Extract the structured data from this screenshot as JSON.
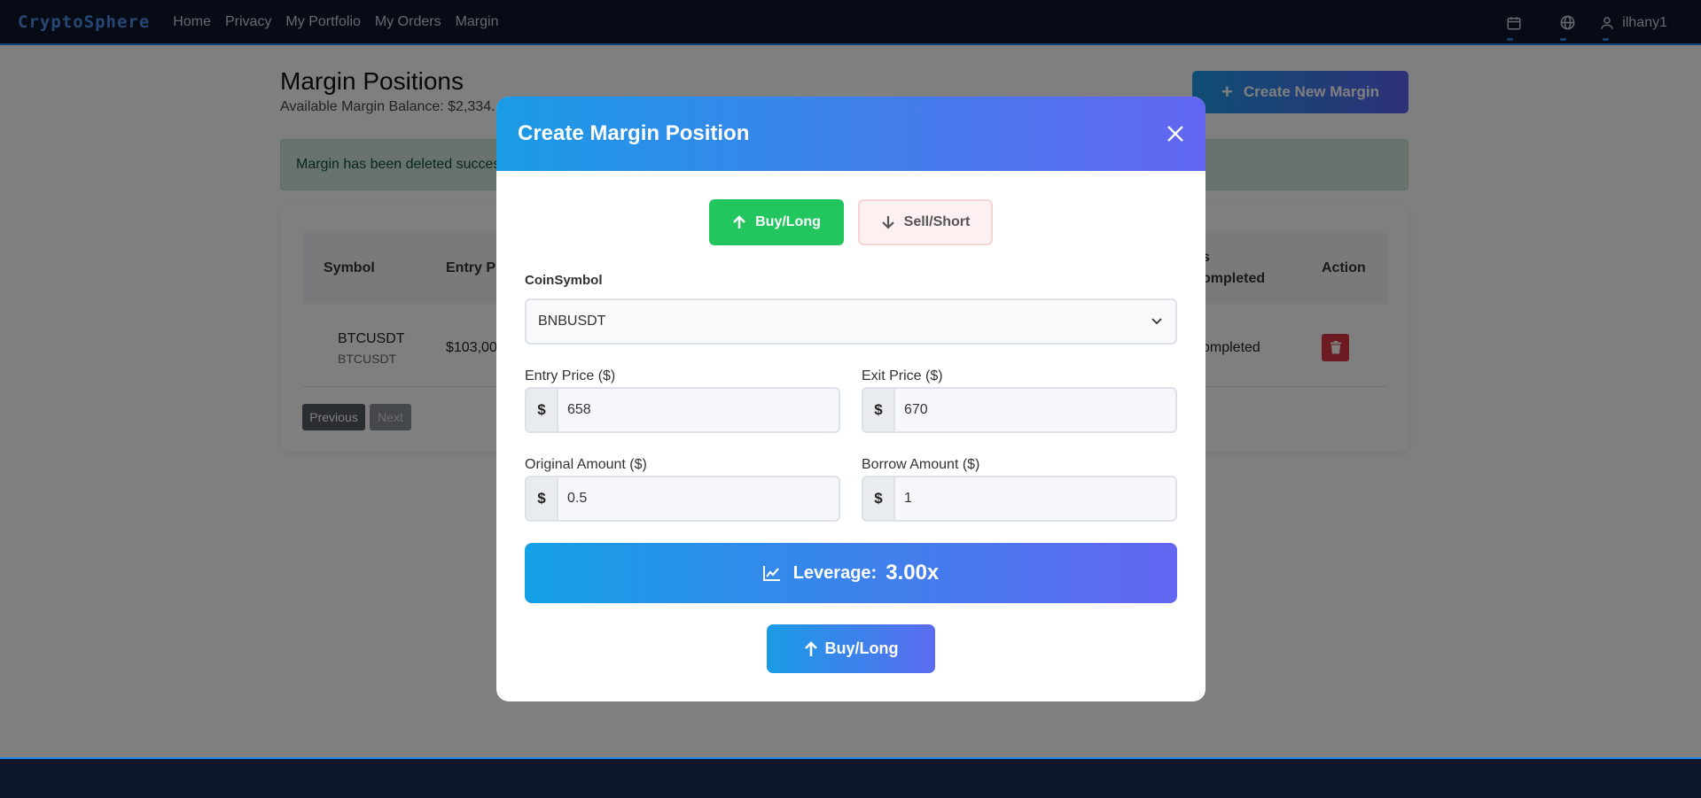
{
  "nav": {
    "brand": "CryptoSphere",
    "links": [
      "Home",
      "Privacy",
      "My Portfolio",
      "My Orders",
      "Margin"
    ],
    "user": "ilhany1",
    "accent": "#1e88e5"
  },
  "page": {
    "title": "Margin Positions",
    "balance": "Available Margin Balance: $2,334.",
    "create_button": "Create New Margin",
    "alert": "Margin has been deleted succes"
  },
  "table": {
    "headers": {
      "symbol": "Symbol",
      "entry": "Entry P",
      "status_top": "s",
      "status": "ompleted",
      "action": "Action"
    },
    "row": {
      "symbol": "BTCUSDT",
      "symbol_sub": "BTCUSDT",
      "entry": "$103,00",
      "status": "ompleted"
    },
    "pagination": {
      "previous": "Previous",
      "next": "Next"
    }
  },
  "modal": {
    "title": "Create Margin Position",
    "buy_toggle": "Buy/Long",
    "sell_toggle": "Sell/Short",
    "coin_label": "CoinSymbol",
    "coin_value": "BNBUSDT",
    "entry_label": "Entry Price ($)",
    "entry_value": "658",
    "exit_label": "Exit Price ($)",
    "exit_value": "670",
    "original_label": "Original Amount ($)",
    "original_value": "0.5",
    "borrow_label": "Borrow Amount ($)",
    "borrow_value": "1",
    "currency_prefix": "$",
    "leverage_label": "Leverage:",
    "leverage_value": "3.00x",
    "submit": "Buy/Long",
    "buy_color": "#22c55e"
  }
}
